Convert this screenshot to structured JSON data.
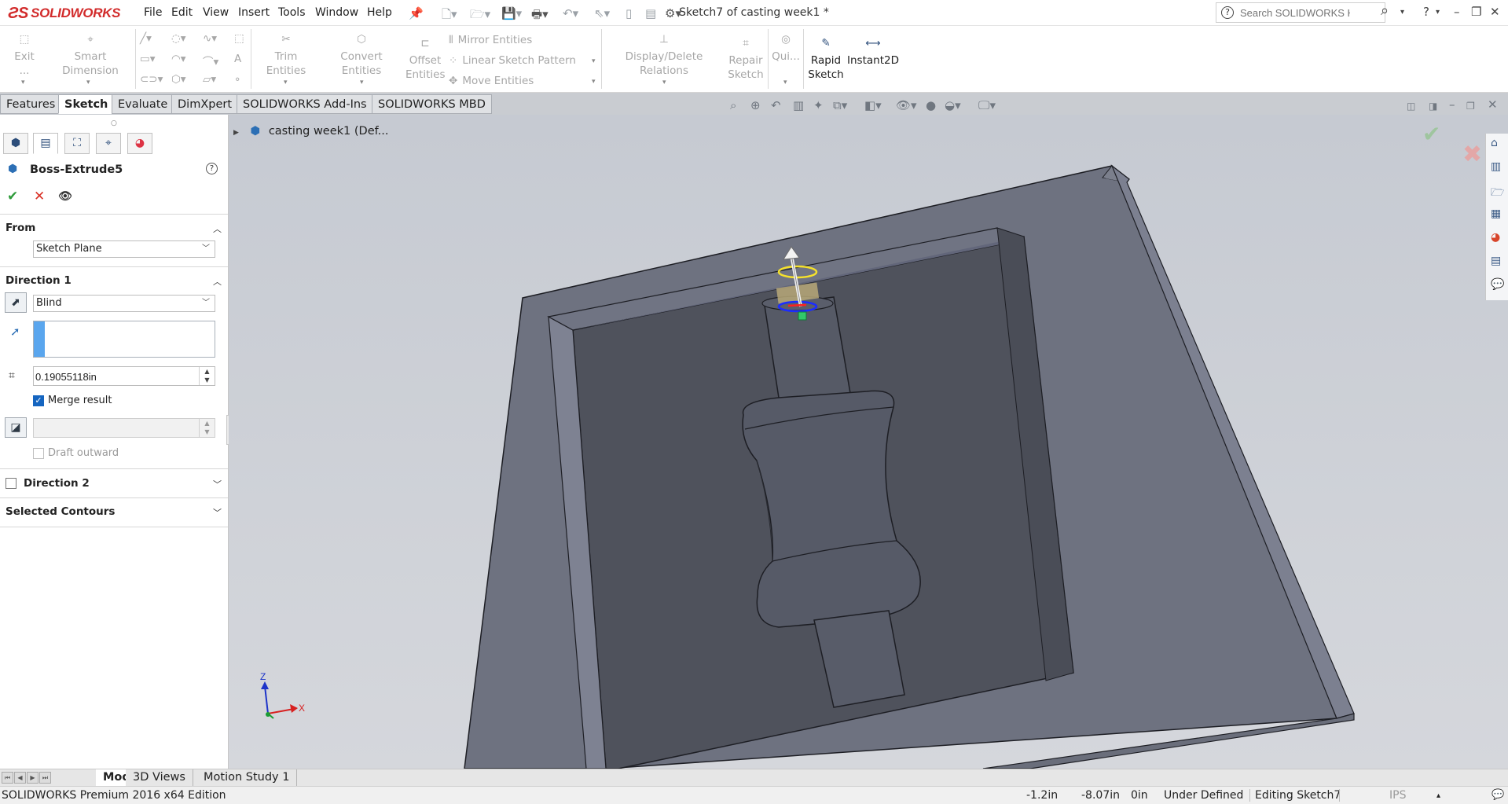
{
  "app": {
    "logo_text": "SOLIDWORKS",
    "document_title": "Sketch7 of casting week1 *"
  },
  "menu": [
    "File",
    "Edit",
    "View",
    "Insert",
    "Tools",
    "Window",
    "Help"
  ],
  "search": {
    "placeholder": "Search SOLIDWORKS Help"
  },
  "window_controls": {
    "help": "?",
    "minimize": "–",
    "restore": "❐",
    "close": "✕"
  },
  "command_manager": {
    "exit_sketch": "Exit ...",
    "smart_dimension": "Smart Dimension",
    "trim_entities": "Trim Entities",
    "convert_entities": "Convert Entities",
    "offset_entities_1": "Offset",
    "offset_entities_2": "Entities",
    "mirror_entities": "Mirror Entities",
    "linear_sketch_pattern": "Linear Sketch Pattern",
    "move_entities": "Move Entities",
    "display_delete_relations": "Display/Delete Relations",
    "repair_sketch_1": "Repair",
    "repair_sketch_2": "Sketch",
    "quick_snaps": "Qui...",
    "rapid_sketch_1": "Rapid",
    "rapid_sketch_2": "Sketch",
    "instant2d": "Instant2D"
  },
  "tabs": [
    "Features",
    "Sketch",
    "Evaluate",
    "DimXpert",
    "SOLIDWORKS Add-Ins",
    "SOLIDWORKS MBD"
  ],
  "active_tab": "Sketch",
  "property_manager": {
    "title": "Boss-Extrude5",
    "help": "?",
    "from": {
      "header": "From",
      "value": "Sketch Plane"
    },
    "direction1": {
      "header": "Direction 1",
      "end_condition": "Blind",
      "depth": "0.19055118in",
      "merge_result_label": "Merge result",
      "merge_result_checked": true,
      "draft_outward_label": "Draft outward",
      "draft_outward_checked": false
    },
    "direction2": {
      "header": "Direction 2",
      "checked": false
    },
    "selected_contours": {
      "header": "Selected Contours"
    }
  },
  "feature_tree_flyout": {
    "label": "casting week1  (Def..."
  },
  "triad": {
    "x": "X",
    "z": "Z"
  },
  "bottom_tabs": [
    "Model",
    "3D Views",
    "Motion Study 1"
  ],
  "active_bottom_tab": "Model",
  "status_bar": {
    "edition": "SOLIDWORKS Premium 2016 x64 Edition",
    "x": "-1.2in",
    "y": "-8.07in",
    "z": "0in",
    "state": "Under Defined",
    "editing": "Editing Sketch7",
    "units": "IPS"
  },
  "colors": {
    "brand": "#d22b2b",
    "viewport_bg": "#c9ccd3",
    "part_face": "#575a66",
    "part_edge": "#1d1e24",
    "accent_blue": "#5aa6ee",
    "ok_green": "#2e9b3a",
    "cancel_red": "#d93025"
  }
}
